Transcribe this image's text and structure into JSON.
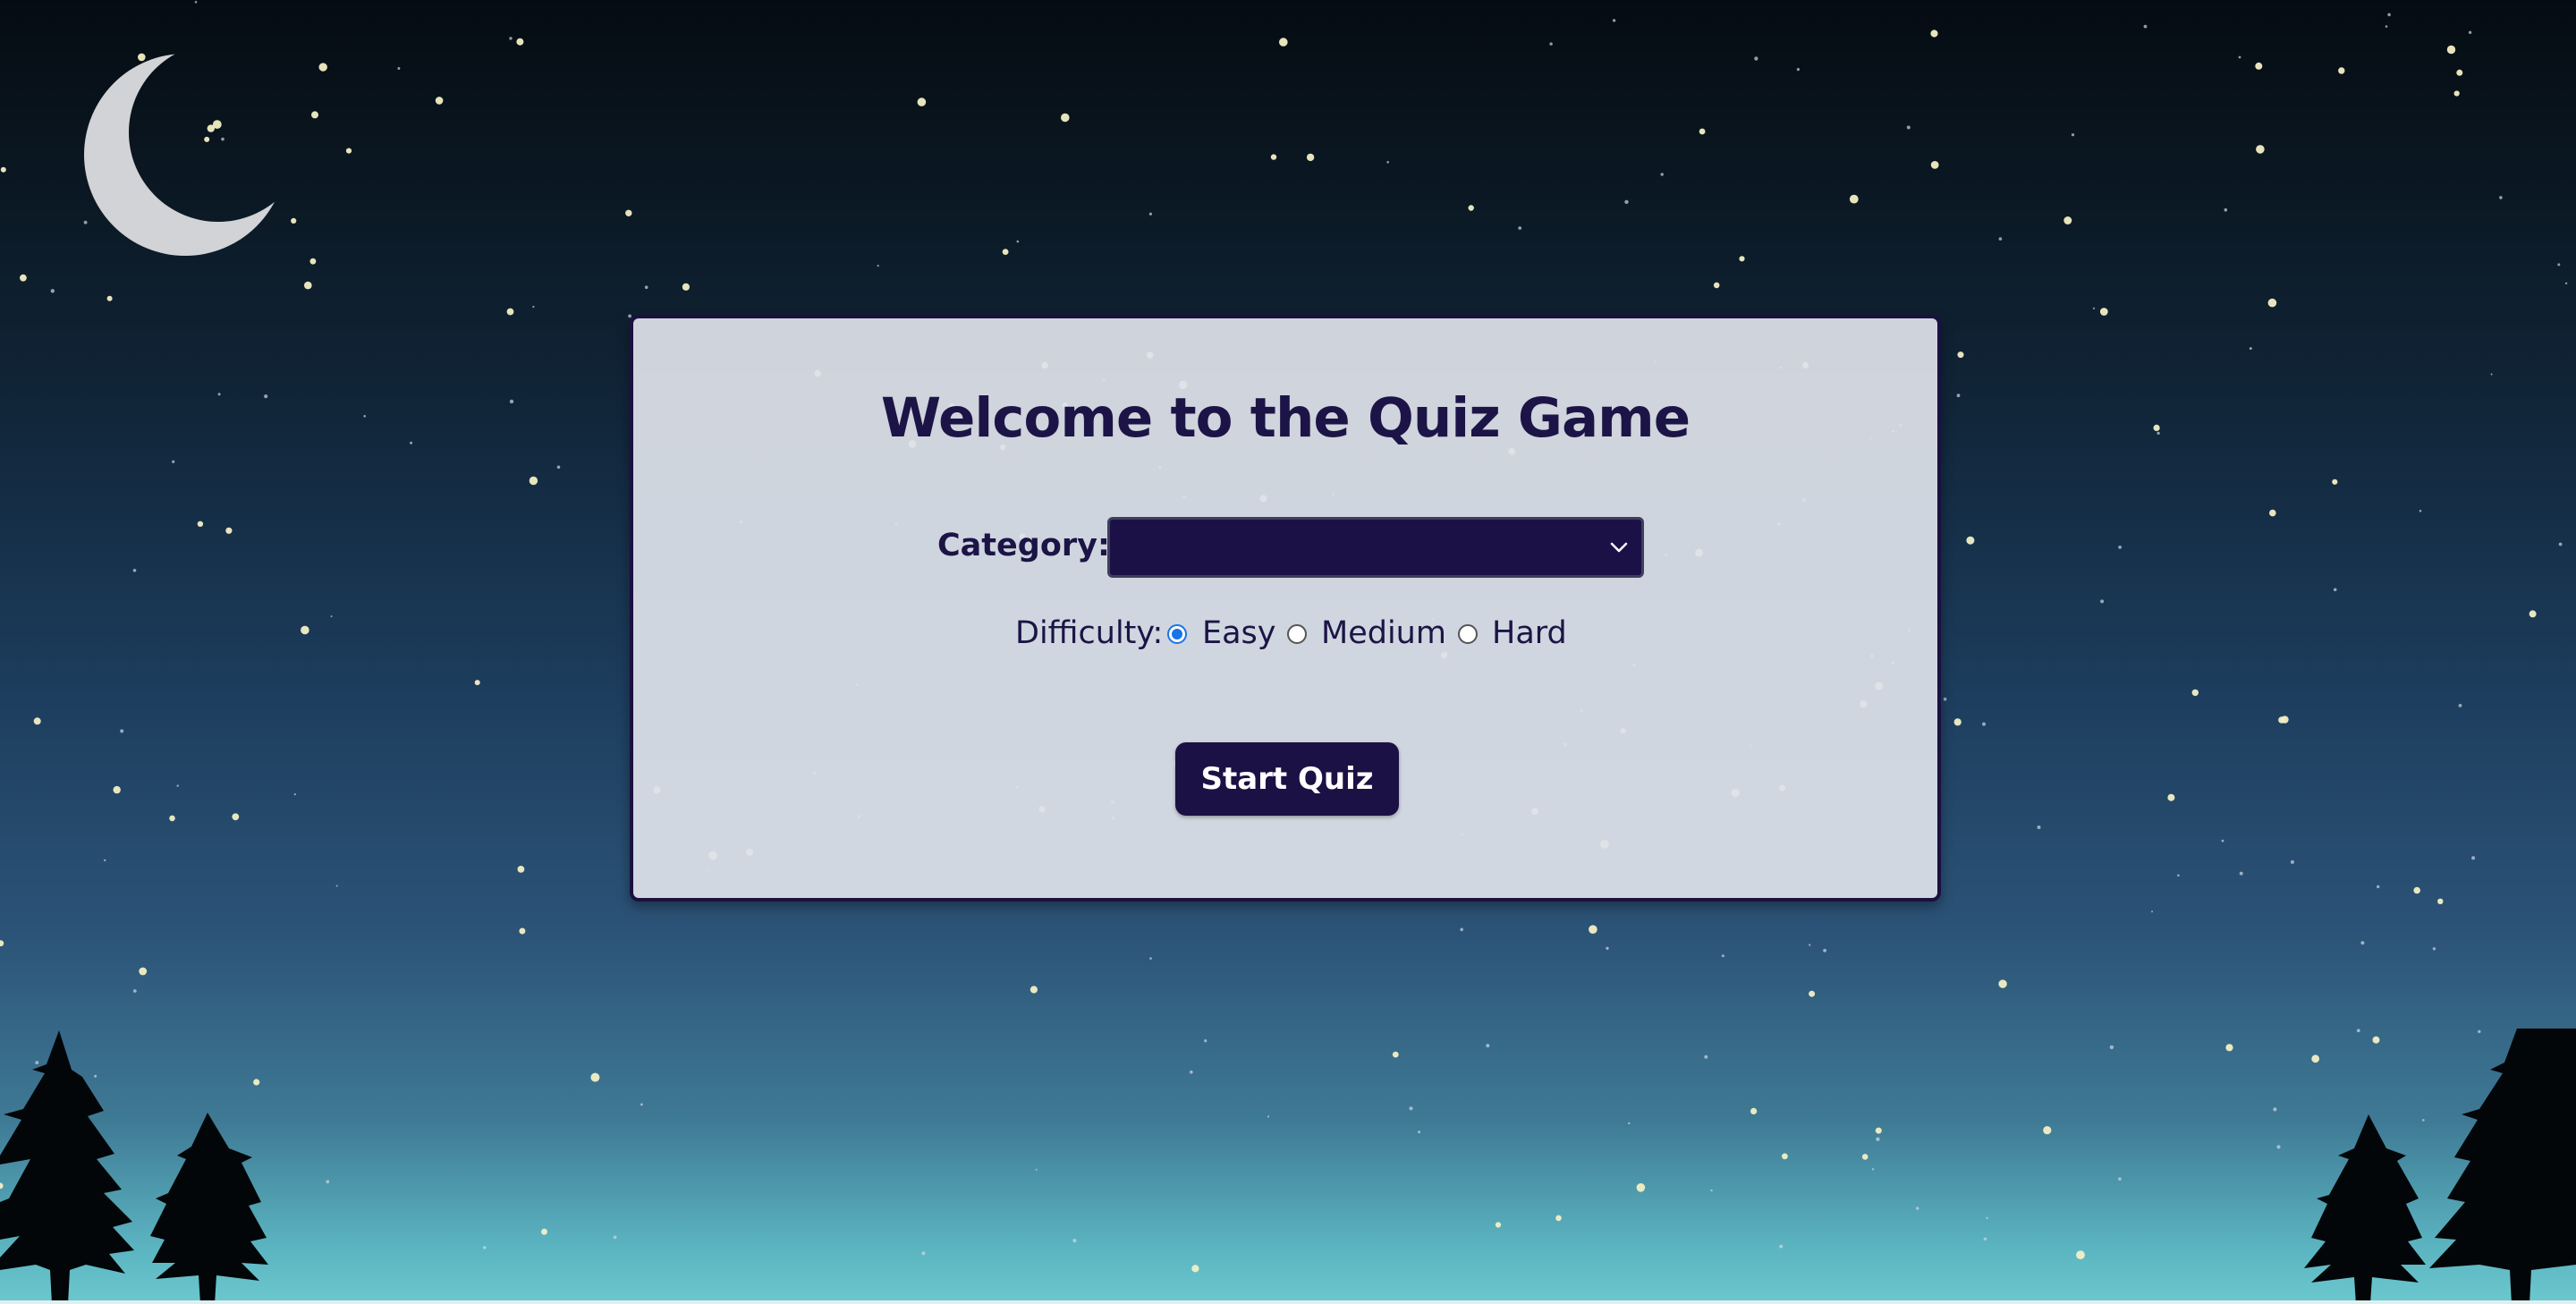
{
  "page": {
    "title": "Welcome to the Quiz Game"
  },
  "form": {
    "category_label": "Category:",
    "category_value": "",
    "difficulty_label": "Difficulty:",
    "difficulty_options": [
      {
        "label": "Easy",
        "checked": true
      },
      {
        "label": "Medium",
        "checked": false
      },
      {
        "label": "Hard",
        "checked": false
      }
    ],
    "start_button_label": "Start Quiz"
  },
  "colors": {
    "accent": "#1c1446",
    "card_background": "#dee2e9",
    "select_background": "#1b1147",
    "radio_selected": "#1a73e8",
    "sky_top": "#050b12",
    "sky_bottom": "#6cc8ce"
  },
  "icons": {
    "moon": "crescent-moon-icon",
    "trees": "pine-tree-icon",
    "dropdown": "chevron-down-icon"
  }
}
